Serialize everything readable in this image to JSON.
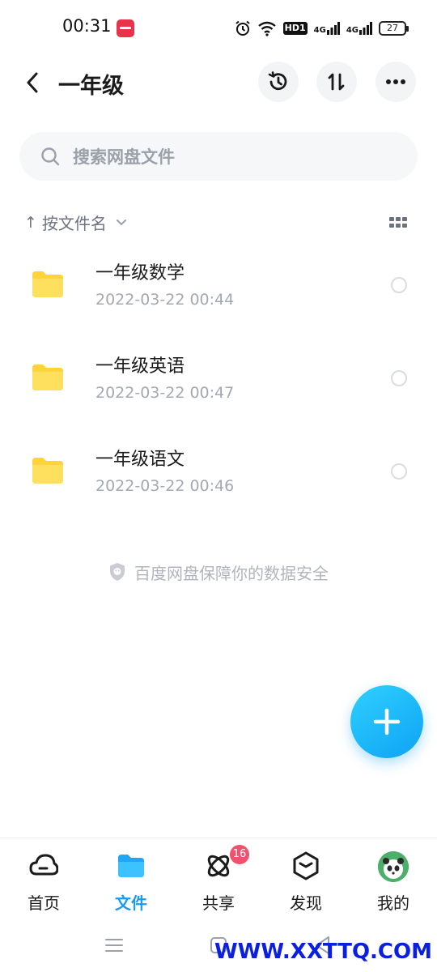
{
  "status_bar": {
    "time": "00:31",
    "battery_level": "27",
    "network_labels": [
      "HD1",
      "4G",
      "4G"
    ],
    "icons": [
      "app-notification-icon",
      "alarm-icon",
      "wifi-icon",
      "hd-icon",
      "signal-4g-icon",
      "signal-4g-icon",
      "battery-icon"
    ]
  },
  "header": {
    "title": "一年级",
    "icons": [
      "back-arrow-icon",
      "history-icon",
      "sort-icon",
      "more-icon"
    ]
  },
  "search": {
    "placeholder": "搜索网盘文件"
  },
  "sort_bar": {
    "arrow": "↑",
    "label": "按文件名",
    "view_toggle_icon": "grid-view-icon"
  },
  "files": [
    {
      "name": "一年级数学",
      "date": "2022-03-22  00:44",
      "icon": "folder-icon"
    },
    {
      "name": "一年级英语",
      "date": "2022-03-22  00:47",
      "icon": "folder-icon"
    },
    {
      "name": "一年级语文",
      "date": "2022-03-22  00:46",
      "icon": "folder-icon"
    }
  ],
  "security_note": "百度网盘保障你的数据安全",
  "fab": {
    "icon": "plus-icon"
  },
  "bottom_nav": {
    "items": [
      {
        "label": "首页",
        "icon": "cloud-icon",
        "active": false
      },
      {
        "label": "文件",
        "icon": "folder-icon",
        "active": true
      },
      {
        "label": "共享",
        "icon": "orbit-icon",
        "active": false,
        "badge": "16"
      },
      {
        "label": "发现",
        "icon": "discover-box-icon",
        "active": false
      },
      {
        "label": "我的",
        "icon": "avatar",
        "active": false
      }
    ]
  },
  "colors": {
    "accent": "#1b9af7",
    "folder": "#ffd43b",
    "badge": "#f0516c"
  },
  "watermark": "WWW.XXTTQ.COM"
}
